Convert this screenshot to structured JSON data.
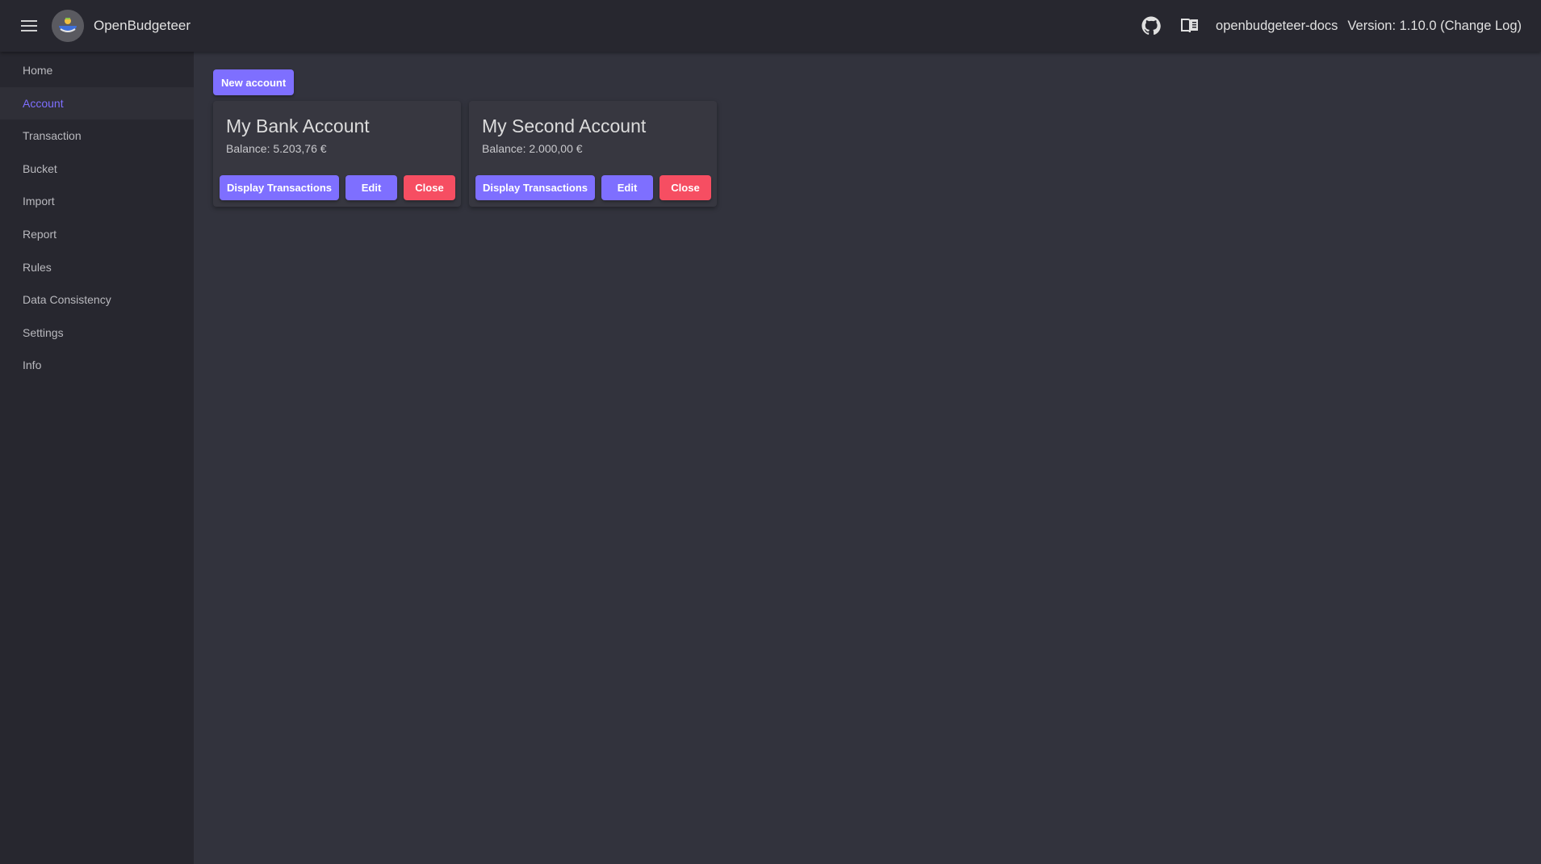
{
  "app": {
    "title": "OpenBudgeteer",
    "docs_link": "openbudgeteer-docs",
    "version_text": "Version: 1.10.0 ",
    "changelog_text": "(Change Log)",
    "icons": [
      "menu-icon",
      "github-icon",
      "book-icon"
    ]
  },
  "sidebar": {
    "items": [
      {
        "label": "Home"
      },
      {
        "label": "Account"
      },
      {
        "label": "Transaction"
      },
      {
        "label": "Bucket"
      },
      {
        "label": "Import"
      },
      {
        "label": "Report"
      },
      {
        "label": "Rules"
      },
      {
        "label": "Data Consistency"
      },
      {
        "label": "Settings"
      },
      {
        "label": "Info"
      }
    ],
    "active": "Account"
  },
  "main": {
    "new_account_label": "New account",
    "accounts": [
      {
        "name": "My Bank Account",
        "balance": "Balance: 5.203,76 €",
        "display_label": "Display Transactions",
        "edit_label": "Edit",
        "close_label": "Close"
      },
      {
        "name": "My Second Account",
        "balance": "Balance: 2.000,00 €",
        "display_label": "Display Transactions",
        "edit_label": "Edit",
        "close_label": "Close"
      }
    ]
  },
  "colors": {
    "primary": "#7e6fff",
    "error": "#f64e62",
    "appbar": "#27272f",
    "background": "#32333d"
  }
}
